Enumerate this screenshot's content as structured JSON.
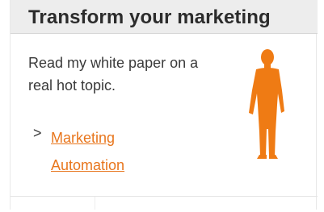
{
  "header": {
    "title": "Transform your marketing"
  },
  "content": {
    "intro_text": "Read my white paper on a real hot topic.",
    "chevron": ">",
    "link_text": "Marketing Automation"
  },
  "colors": {
    "accent": "#e8761d",
    "figure": "#ef7b14",
    "header_bg": "#ededed",
    "text": "#3a3a3a"
  },
  "icons": {
    "figure": "person-silhouette-icon",
    "chevron": "chevron-right-icon"
  }
}
